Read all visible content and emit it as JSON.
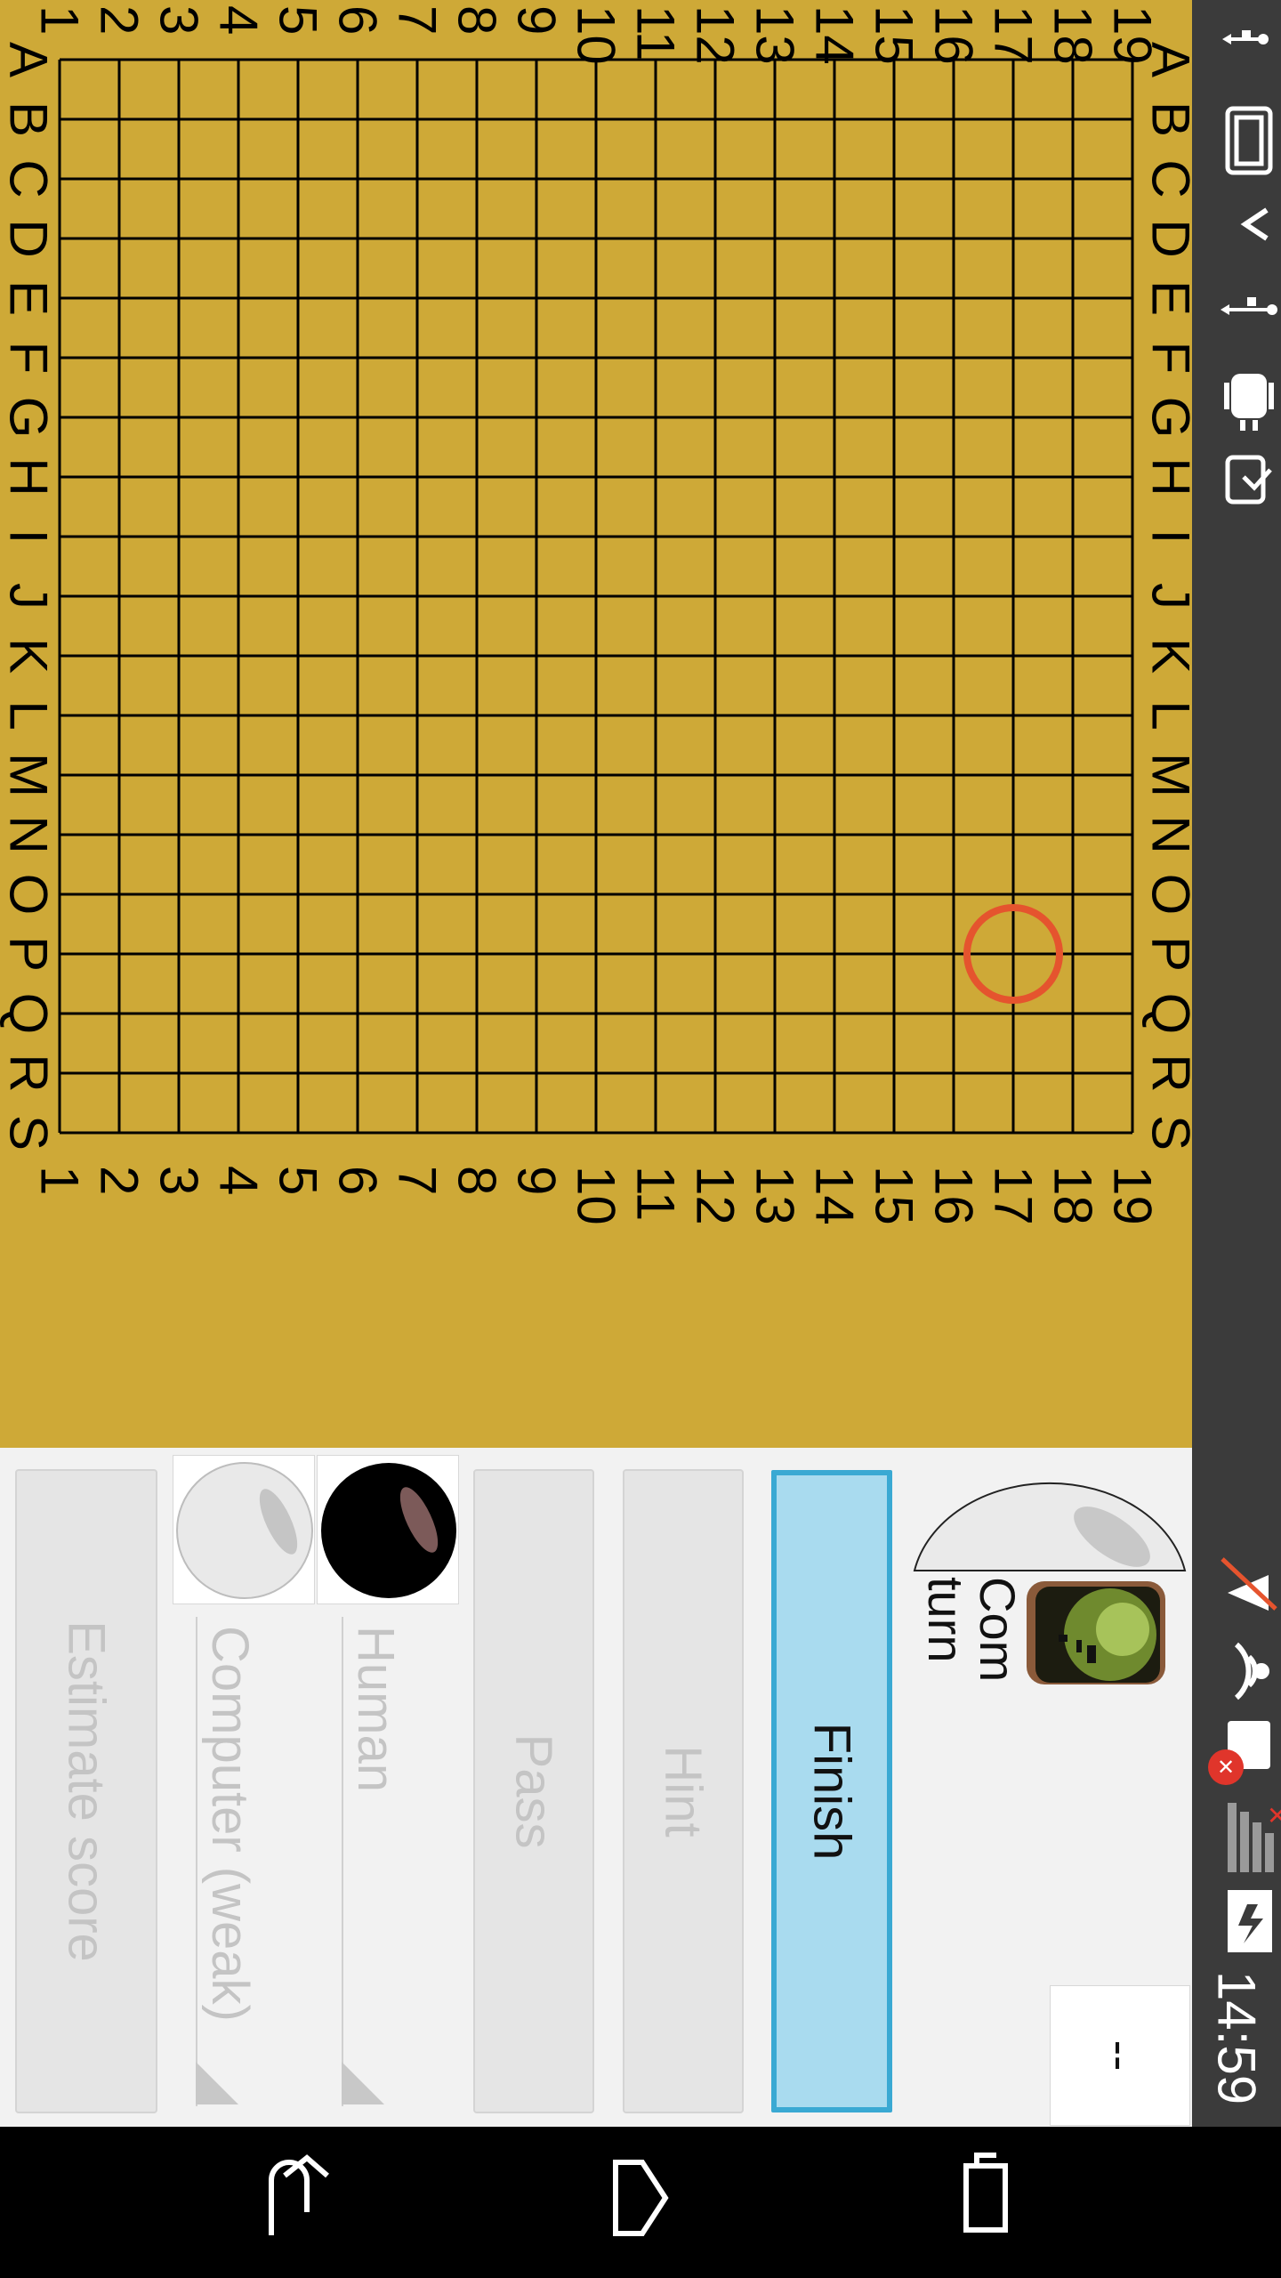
{
  "board": {
    "size": 19,
    "column_labels": [
      "1",
      "2",
      "3",
      "4",
      "5",
      "6",
      "7",
      "8",
      "9",
      "10",
      "11",
      "12",
      "13",
      "14",
      "15",
      "16",
      "17",
      "18",
      "19"
    ],
    "row_labels": [
      "A",
      "B",
      "C",
      "D",
      "E",
      "F",
      "G",
      "H",
      "I",
      "J",
      "K",
      "L",
      "M",
      "N",
      "O",
      "P",
      "Q",
      "R",
      "S"
    ],
    "cursor_marker": {
      "row": "P",
      "column": "17",
      "color": "#e5542e"
    },
    "colors": {
      "wood": "#cea937",
      "line": "#000000"
    }
  },
  "controls": {
    "estimate_score_label": "Estimate score",
    "computer_player_label": "Computer (weak)",
    "human_player_label": "Human",
    "pass_label": "Pass",
    "hint_label": "Hint",
    "finish_label": "Finish",
    "turn_line1": "Com",
    "turn_line2": "turn",
    "move_counter": "--"
  },
  "status_bar": {
    "time": "14:59",
    "icons": [
      "usb-icon",
      "clipboard-icon",
      "chevron-icon",
      "usb-icon",
      "android-debug-icon",
      "download-icon",
      "mute-icon",
      "wifi-icon",
      "sim-error-icon",
      "signal-icon",
      "battery-charging-icon"
    ]
  },
  "nav_bar": {
    "icons": [
      "back-icon",
      "home-icon",
      "recents-icon"
    ]
  }
}
